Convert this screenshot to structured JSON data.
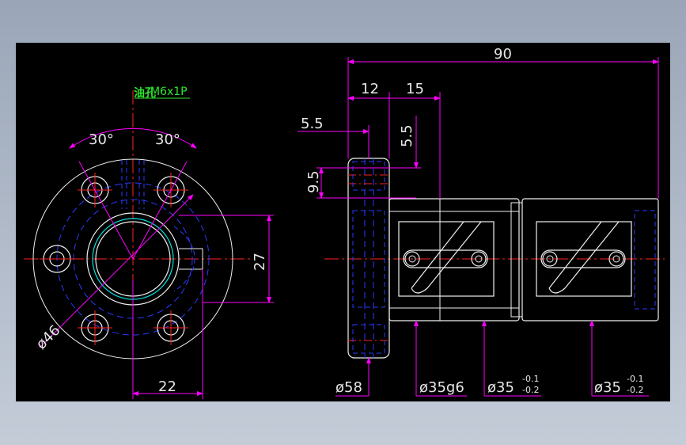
{
  "drawing": {
    "left_view": {
      "oil_hole_label": "油孔",
      "thread_label": "M6x1P",
      "angle_left": "30°",
      "angle_right": "30°",
      "dim_vertical": "27",
      "dim_horizontal": "22",
      "dim_diameter": "ø46"
    },
    "right_view": {
      "overall_length": "90",
      "flange_width": "12",
      "step_length": "15",
      "offset_top": "5.5",
      "offset_vertical": "5.5",
      "hole_pitch": "9.5",
      "dia_flange": "ø58",
      "dia_body": "ø35g6",
      "dia_mid_base": "ø35",
      "dia_mid_tol_upper": "-0.1",
      "dia_mid_tol_lower": "-0.2",
      "dia_end_base": "ø35",
      "dia_end_tol_upper": "-0.1",
      "dia_end_tol_lower": "-0.2"
    },
    "colors": {
      "background": "#000000",
      "outline": "#f0f0f0",
      "dimension": "#ff00ff",
      "center_line": "#ff2020",
      "hidden_line": "#2a3aff",
      "thread": "#00e0e0",
      "text": "#e6e6e6",
      "label": "#2ee82e"
    }
  }
}
